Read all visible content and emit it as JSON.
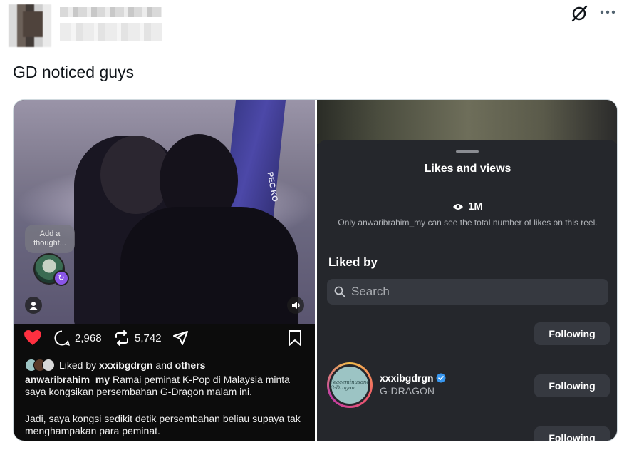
{
  "tweet": {
    "text": "GD noticed guys"
  },
  "icons": {
    "grok": "grok-icon",
    "more": "more-icon"
  },
  "left_panel": {
    "thought_bubble": "Add a thought...",
    "flag_letters": "PEC KO",
    "counts": {
      "comments": "2,968",
      "reposts": "5,742"
    },
    "liked_by_prefix": "Liked by",
    "liked_by_user": "xxxibgdrgn",
    "liked_by_and": "and",
    "liked_by_others": "others",
    "caption_user": "anwaribrahim_my",
    "caption_text": "Ramai peminat K-Pop di Malaysia minta saya kongsikan persembahan G-Dragon malam ini.",
    "caption_text2": "Jadi, saya kongsi sedikit detik persembahan beliau supaya tak menghampakan para peminat."
  },
  "right_panel": {
    "title": "Likes and views",
    "views_count": "1M",
    "views_note": "Only anwaribrahim_my can see the total number of likes on this reel.",
    "liked_by_heading": "Liked by",
    "search_placeholder": "Search",
    "following_label": "Following",
    "user": {
      "username": "xxxibgdrgn",
      "display_name": "G-DRAGON",
      "avatar_text": "Peaceminusone G-Dragon"
    }
  },
  "colors": {
    "heart": "#ff3040",
    "verified": "#3897f0",
    "story_badge": "#8a56e8"
  }
}
